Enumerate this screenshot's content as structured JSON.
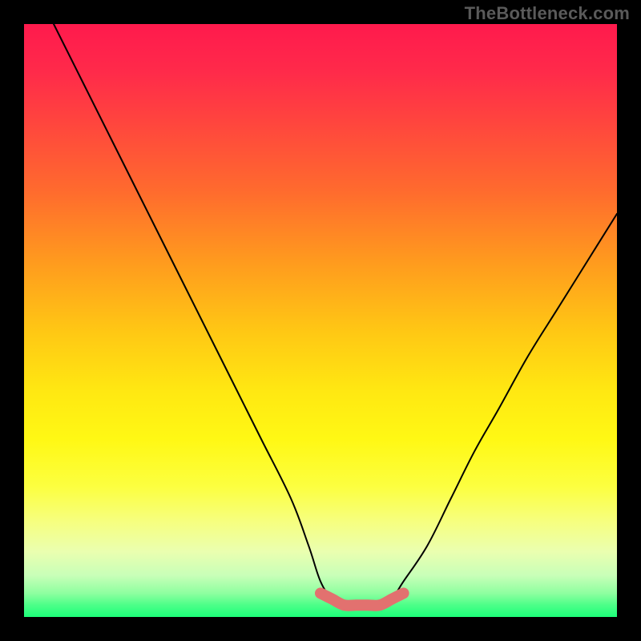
{
  "watermark": "TheBottleneck.com",
  "chart_data": {
    "type": "line",
    "title": "",
    "xlabel": "",
    "ylabel": "",
    "xlim": [
      0,
      100
    ],
    "ylim": [
      0,
      100
    ],
    "series": [
      {
        "name": "bottleneck-curve",
        "x": [
          5,
          10,
          15,
          20,
          25,
          30,
          35,
          40,
          45,
          48,
          50,
          52,
          54,
          56,
          58,
          60,
          62,
          64,
          68,
          72,
          76,
          80,
          85,
          90,
          95,
          100
        ],
        "values": [
          100,
          90,
          80,
          70,
          60,
          50,
          40,
          30,
          20,
          12,
          6,
          3,
          2,
          2,
          2,
          2,
          3,
          6,
          12,
          20,
          28,
          35,
          44,
          52,
          60,
          68
        ]
      },
      {
        "name": "optimal-band",
        "x": [
          50,
          52,
          54,
          56,
          58,
          60,
          62,
          64
        ],
        "values": [
          4,
          3,
          2,
          2,
          2,
          2,
          3,
          4
        ]
      }
    ],
    "annotations": []
  },
  "colors": {
    "curve": "#000000",
    "band": "#e2716f",
    "gradient_top": "#ff1a4d",
    "gradient_mid": "#ffe812",
    "gradient_bottom": "#1dff7a"
  }
}
